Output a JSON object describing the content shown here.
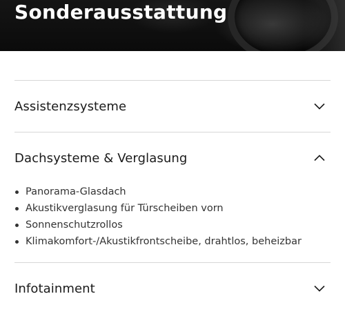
{
  "hero": {
    "title": "Sonderausstattung"
  },
  "accordion": {
    "sections": [
      {
        "label": "Assistenzsysteme",
        "expanded": false,
        "icon": "chevron-down-icon"
      },
      {
        "label": "Dachsysteme & Verglasung",
        "expanded": true,
        "icon": "chevron-up-icon",
        "items": [
          "Panorama-Glasdach",
          "Akustikverglasung für Türscheiben vorn",
          "Sonnenschutzrollos",
          "Klimakomfort-/Akustikfrontscheibe, drahtlos, beheizbar"
        ]
      },
      {
        "label": "Infotainment",
        "expanded": false,
        "icon": "chevron-down-icon"
      }
    ]
  },
  "colors": {
    "hero_bg": "#0b0b0b",
    "divider": "#d7d7d7",
    "text": "#1a1a1a"
  }
}
